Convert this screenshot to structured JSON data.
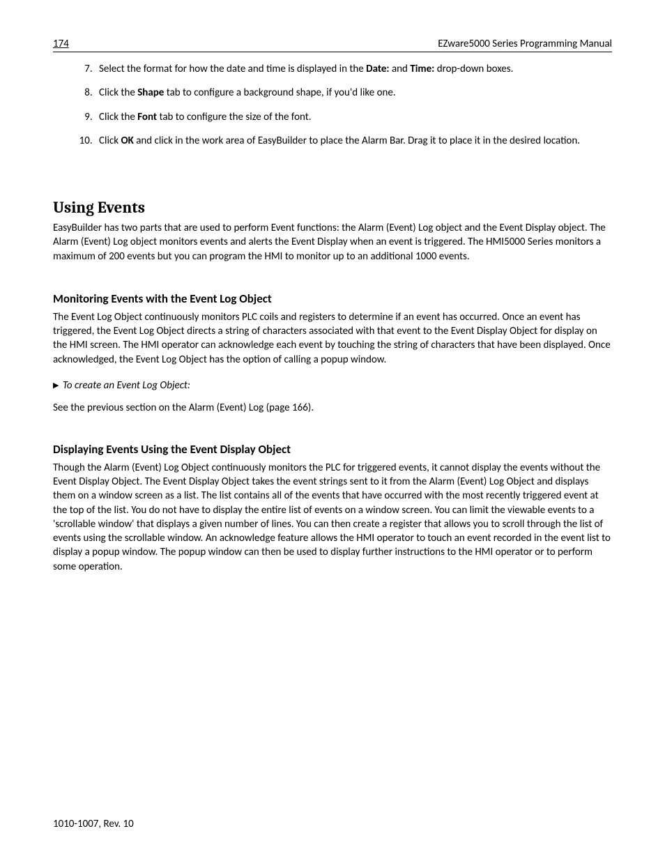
{
  "header": {
    "page_number": "174",
    "title": "EZware5000 Series Programming Manual"
  },
  "steps": {
    "start": 7,
    "items": [
      {
        "pre": "Select the format for how the date and time is displayed in the ",
        "b1": "Date:",
        "mid": " and ",
        "b2": "Time:",
        "post": " drop-down boxes."
      },
      {
        "pre": "Click the ",
        "b1": "Shape",
        "mid": "",
        "b2": "",
        "post": " tab to configure a background shape, if you'd like one."
      },
      {
        "pre": "Click the ",
        "b1": "Font",
        "mid": "",
        "b2": "",
        "post": " tab to configure the size of the font."
      },
      {
        "pre": "Click ",
        "b1": "OK",
        "mid": "",
        "b2": "",
        "post": " and click in the work area of EasyBuilder to place the Alarm Bar. Drag it to place it in the desired location."
      }
    ]
  },
  "section": {
    "heading": "Using Events",
    "intro": "EasyBuilder has two parts that are used to perform Event functions: the Alarm (Event) Log object and the Event Display object. The Alarm (Event) Log object monitors events and alerts the Event Display when an event is triggered. The HMI5000 Series monitors a maximum of 200 events but you can program the HMI to monitor up to an additional 1000 events."
  },
  "sub1": {
    "heading": "Monitoring Events with the Event Log Object",
    "body": "The Event Log Object continuously monitors PLC coils and registers to determine if an event has occurred. Once an event has triggered, the Event Log Object directs a string of characters associated with that event to the Event Display Object for display on the HMI screen. The HMI operator can acknowledge each event by touching the string of characters that have been displayed. Once acknowledged, the Event Log Object has the option of calling a popup window.",
    "task": "To create an Event Log Object:",
    "note": "See the previous section on the Alarm (Event) Log (page 166)."
  },
  "sub2": {
    "heading": "Displaying Events Using the Event Display Object",
    "body": "Though the Alarm (Event) Log Object continuously monitors the PLC for triggered events, it cannot display the events without the Event Display Object. The Event Display Object takes the event strings sent to it from the Alarm (Event) Log Object and displays them on a window screen as a list. The list contains all of the events that have occurred with the most recently triggered event at the top of the list. You do not have to display the entire list of events on a window screen. You can limit the viewable events to a 'scrollable window' that displays a given number of lines. You can then create a register that allows you to scroll through the list of events using the scrollable window. An acknowledge feature allows the HMI operator to touch an event recorded in the event list to display a popup window. The popup window can then be used to display further instructions to the HMI operator or to perform some operation."
  },
  "footer": "1010-1007, Rev. 10"
}
